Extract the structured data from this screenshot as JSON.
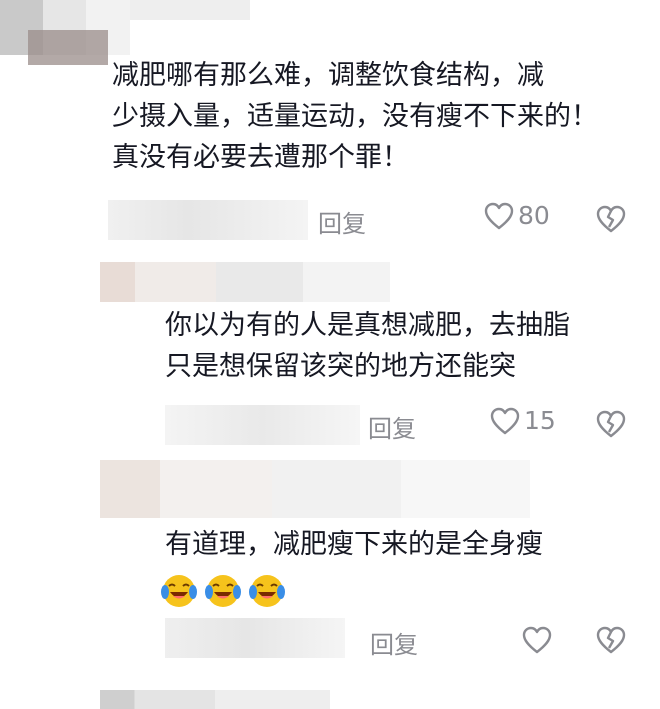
{
  "comments": [
    {
      "text": "减肥哪有那么难，调整饮食结构，减\n少摄入量，适量运动，没有瘦不下来的！\n真没有必要去遭那个罪！",
      "reply_label": "回复",
      "like_count": "80"
    },
    {
      "text": "你以为有的人是真想减肥，去抽脂\n只是想保留该突的地方还能突",
      "reply_label": "回复",
      "like_count": "15"
    },
    {
      "text": "有道理，减肥瘦下来的是全身瘦",
      "emojis": [
        "laughing-crying",
        "laughing-crying",
        "laughing-crying"
      ],
      "reply_label": "回复",
      "like_count": ""
    }
  ],
  "icons": {
    "like": "heart-icon",
    "dislike": "broken-heart-icon"
  },
  "colors": {
    "text": "#161823",
    "meta": "#8a8b91",
    "emoji_face": "#f6c31c",
    "emoji_tear": "#3a8ee6"
  }
}
